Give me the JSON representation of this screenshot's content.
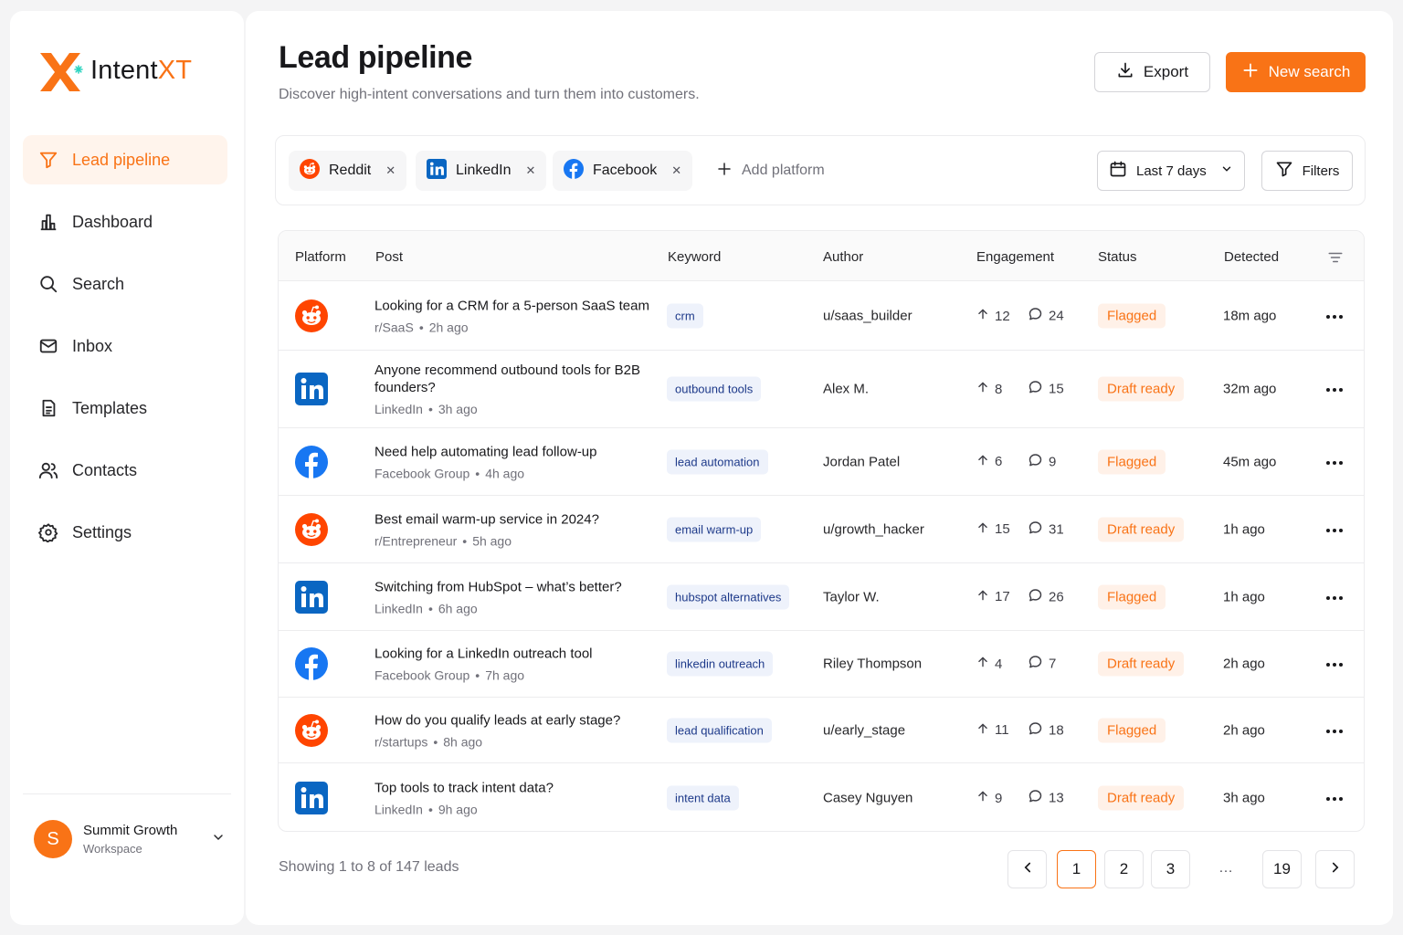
{
  "app": {
    "name_primary": "Intent",
    "name_accent": "XT",
    "colors": {
      "accent": "#f97316",
      "reddit": "#ff4500",
      "linkedin": "#0a66c2",
      "facebook": "#1877f2"
    }
  },
  "sidebar": {
    "items": [
      {
        "label": "Lead pipeline",
        "icon": "funnel-icon",
        "active": true
      },
      {
        "label": "Dashboard",
        "icon": "bar-chart-icon"
      },
      {
        "label": "Search",
        "icon": "search-icon"
      },
      {
        "label": "Inbox",
        "icon": "mail-icon"
      },
      {
        "label": "Templates",
        "icon": "document-icon"
      },
      {
        "label": "Contacts",
        "icon": "users-icon"
      },
      {
        "label": "Settings",
        "icon": "gear-icon"
      }
    ],
    "workspace": {
      "initial": "S",
      "name": "Summit Growth",
      "sub": "Workspace"
    }
  },
  "header": {
    "title": "Lead pipeline",
    "subtitle": "Discover high-intent conversations and turn them into customers.",
    "export_label": "Export",
    "new_search_label": "New search"
  },
  "filters": {
    "platforms": [
      {
        "label": "Reddit",
        "icon": "reddit-icon"
      },
      {
        "label": "LinkedIn",
        "icon": "linkedin-icon"
      },
      {
        "label": "Facebook",
        "icon": "facebook-icon"
      }
    ],
    "add_platform_label": "Add platform",
    "date_range": "Last 7 days",
    "filters_label": "Filters"
  },
  "table": {
    "columns": [
      "Platform",
      "Post",
      "Keyword",
      "Author",
      "Engagement",
      "Status",
      "Detected"
    ],
    "rows": [
      {
        "platform": "reddit",
        "title": "Looking for a CRM for a 5-person SaaS team",
        "source": "r/SaaS",
        "age": "2h ago",
        "keyword": "crm",
        "author": "u/saas_builder",
        "upvotes": "12",
        "comments": "24",
        "status": "Flagged",
        "detected": "18m ago"
      },
      {
        "platform": "linkedin",
        "title": "Anyone recommend outbound tools for B2B founders?",
        "source": "LinkedIn",
        "age": "3h ago",
        "keyword": "outbound tools",
        "author": "Alex M.",
        "upvotes": "8",
        "comments": "15",
        "status": "Draft ready",
        "detected": "32m ago"
      },
      {
        "platform": "facebook",
        "title": "Need help automating lead follow-up",
        "source": "Facebook Group",
        "age": "4h ago",
        "keyword": "lead automation",
        "author": "Jordan Patel",
        "upvotes": "6",
        "comments": "9",
        "status": "Flagged",
        "detected": "45m ago"
      },
      {
        "platform": "reddit",
        "title": "Best email warm-up service in 2024?",
        "source": "r/Entrepreneur",
        "age": "5h ago",
        "keyword": "email warm-up",
        "author": "u/growth_hacker",
        "upvotes": "15",
        "comments": "31",
        "status": "Draft ready",
        "detected": "1h ago"
      },
      {
        "platform": "linkedin",
        "title": "Switching from HubSpot – what’s better?",
        "source": "LinkedIn",
        "age": "6h ago",
        "keyword": "hubspot alternatives",
        "author": "Taylor W.",
        "upvotes": "17",
        "comments": "26",
        "status": "Flagged",
        "detected": "1h ago"
      },
      {
        "platform": "facebook",
        "title": "Looking for a LinkedIn outreach tool",
        "source": "Facebook Group",
        "age": "7h ago",
        "keyword": "linkedin outreach",
        "author": "Riley Thompson",
        "upvotes": "4",
        "comments": "7",
        "status": "Draft ready",
        "detected": "2h ago"
      },
      {
        "platform": "reddit",
        "title": "How do you qualify leads at early stage?",
        "source": "r/startups",
        "age": "8h ago",
        "keyword": "lead qualification",
        "author": "u/early_stage",
        "upvotes": "11",
        "comments": "18",
        "status": "Flagged",
        "detected": "2h ago"
      },
      {
        "platform": "linkedin",
        "title": "Top tools to track intent data?",
        "source": "LinkedIn",
        "age": "9h ago",
        "keyword": "intent data",
        "author": "Casey Nguyen",
        "upvotes": "9",
        "comments": "13",
        "status": "Draft ready",
        "detected": "3h ago"
      }
    ]
  },
  "pagination": {
    "showing": "Showing 1 to 8 of 147 leads",
    "pages": [
      "1",
      "2",
      "3"
    ],
    "current": "1",
    "ellipsis": "…",
    "last": "19"
  }
}
